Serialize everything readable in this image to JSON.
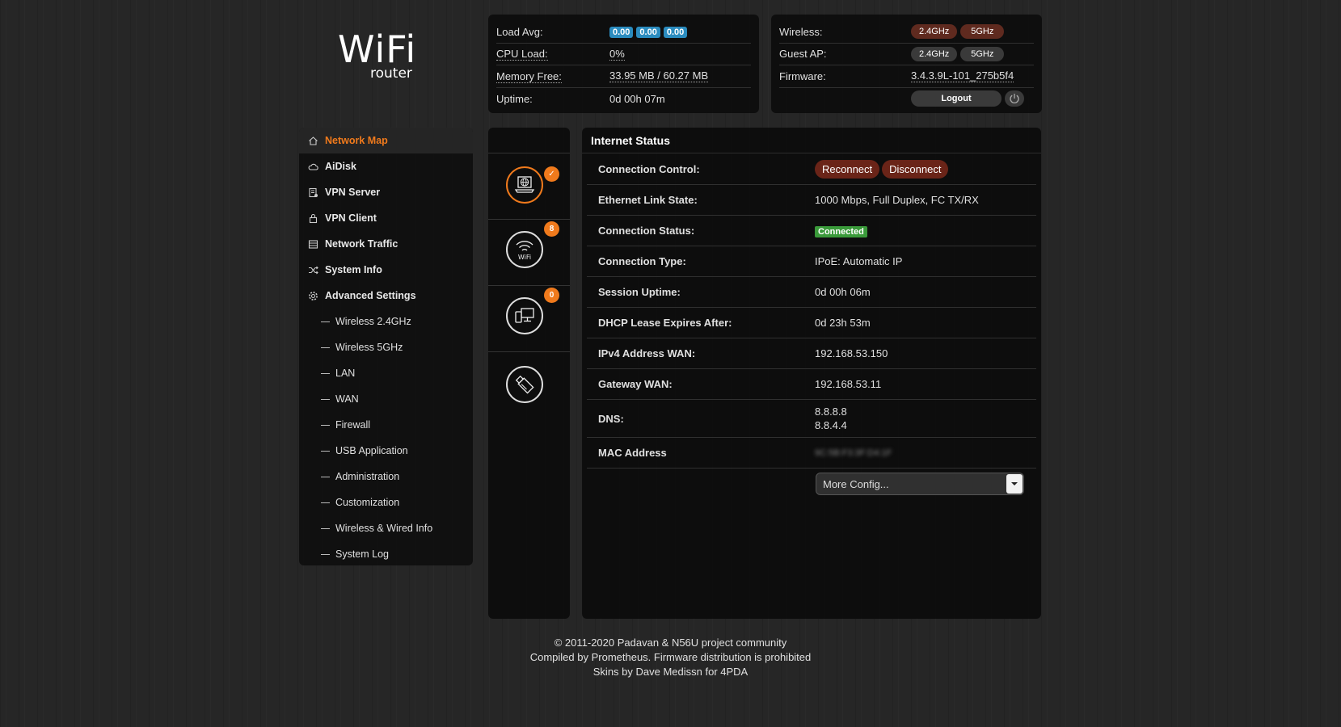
{
  "logo": {
    "wifi": "WiFi",
    "router": "router"
  },
  "system": {
    "load_avg_label": "Load Avg:",
    "load_avg": [
      "0.00",
      "0.00",
      "0.00"
    ],
    "cpu_label": "CPU Load:",
    "cpu_value": "0%",
    "memory_label": "Memory Free:",
    "memory_value": "33.95 MB / 60.27 MB",
    "uptime_label": "Uptime:",
    "uptime_value": "0d 00h 07m"
  },
  "wireless": {
    "wireless_label": "Wireless:",
    "wireless_bands": [
      "2.4GHz",
      "5GHz"
    ],
    "guest_label": "Guest AP:",
    "guest_bands": [
      "2.4GHz",
      "5GHz"
    ],
    "firmware_label": "Firmware:",
    "firmware_value": "3.4.3.9L-101_275b5f4",
    "logout_label": "Logout"
  },
  "sidebar": {
    "items": [
      {
        "label": "Network Map",
        "icon": "home-icon",
        "active": true
      },
      {
        "label": "AiDisk",
        "icon": "cloud-icon"
      },
      {
        "label": "VPN Server",
        "icon": "vpn-server-icon"
      },
      {
        "label": "VPN Client",
        "icon": "vpn-client-icon"
      },
      {
        "label": "Network Traffic",
        "icon": "traffic-icon"
      },
      {
        "label": "System Info",
        "icon": "shuffle-icon"
      },
      {
        "label": "Advanced Settings",
        "icon": "gear-icon"
      }
    ],
    "sub_items": [
      "Wireless 2.4GHz",
      "Wireless 5GHz",
      "LAN",
      "WAN",
      "Firewall",
      "USB Application",
      "Administration",
      "Customization",
      "Wireless & Wired Info",
      "System Log"
    ]
  },
  "status_icons": {
    "internet_badge": "✓",
    "wifi_badge": "8",
    "clients_badge": "0",
    "wifi_text": "WiFi"
  },
  "main": {
    "title": "Internet Status",
    "rows": {
      "connection_control": "Connection Control:",
      "reconnect": "Reconnect",
      "disconnect": "Disconnect",
      "ethernet_label": "Ethernet Link State:",
      "ethernet_value": "1000 Mbps, Full Duplex, FC TX/RX",
      "status_label": "Connection Status:",
      "status_value": "Connected",
      "type_label": "Connection Type:",
      "type_value": "IPoE: Automatic IP",
      "session_label": "Session Uptime:",
      "session_value": "0d 00h 06m",
      "dhcp_label": "DHCP Lease Expires After:",
      "dhcp_value": "0d 23h 53m",
      "ipv4_label": "IPv4 Address WAN:",
      "ipv4_value": "192.168.53.150",
      "gateway_label": "Gateway WAN:",
      "gateway_value": "192.168.53.11",
      "dns_label": "DNS:",
      "dns_values": [
        "8.8.8.8",
        "8.8.4.4"
      ],
      "mac_label": "MAC Address",
      "mac_value": "9C:5B:F3:3F:D4:1F"
    },
    "more_config": "More Config..."
  },
  "footer": {
    "line1": "© 2011-2020 Padavan & N56U project community",
    "line2": "Compiled by Prometheus. Firmware distribution is prohibited",
    "line3": "Skins by Dave Medissn for 4PDA"
  },
  "colors": {
    "accent": "#f07a1c",
    "badge_blue": "#2b8cbf",
    "badge_green": "#3a9a3a",
    "button_red": "#6a2418"
  }
}
